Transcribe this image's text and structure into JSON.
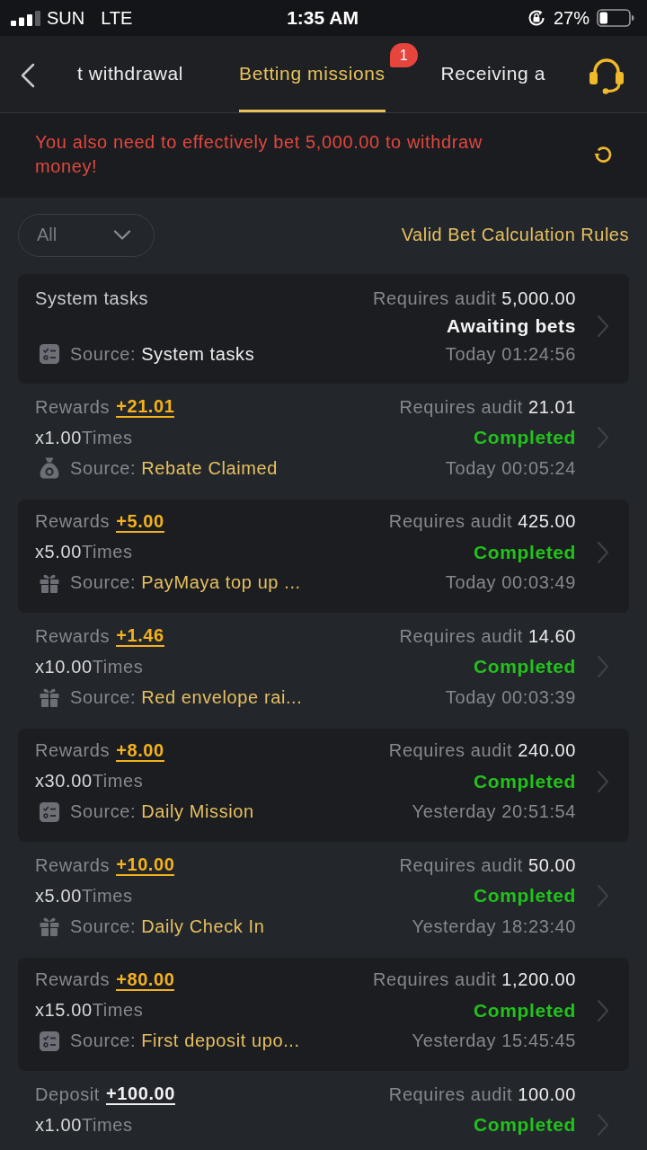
{
  "status_bar": {
    "carrier": "SUN",
    "network": "LTE",
    "time": "1:35 AM",
    "battery": "27%"
  },
  "nav": {
    "tabs": [
      {
        "label": "t withdrawal",
        "selected": false
      },
      {
        "label": "Betting missions",
        "selected": true,
        "badge": "1"
      },
      {
        "label": "Receiving a",
        "selected": false
      }
    ]
  },
  "notice": {
    "text": "You also need to effectively bet 5,000.00 to withdraw money!"
  },
  "filter": {
    "value": "All",
    "rules_link": "Valid Bet Calculation Rules"
  },
  "tasks": [
    {
      "kind": "system",
      "title": "System tasks",
      "audit_label": "Requires audit",
      "audit": "5,000.00",
      "status": {
        "kind": "awaiting",
        "text": "Awaiting bets"
      },
      "source": {
        "kind": "task",
        "label": "Source:",
        "value": "System tasks"
      },
      "time": "Today 01:24:56"
    },
    {
      "kind": "reward",
      "title": "Rewards",
      "amount": "+21.01",
      "multiplier": "x1.00",
      "times": "Times",
      "audit_label": "Requires audit",
      "audit": "21.01",
      "status": {
        "kind": "completed",
        "text": "Completed"
      },
      "source": {
        "kind": "rebate",
        "label": "Source:",
        "value": "Rebate Claimed"
      },
      "time": "Today 00:05:24"
    },
    {
      "kind": "reward",
      "title": "Rewards",
      "amount": "+5.00",
      "multiplier": "x5.00",
      "times": "Times",
      "audit_label": "Requires audit",
      "audit": "425.00",
      "status": {
        "kind": "completed",
        "text": "Completed"
      },
      "source": {
        "kind": "gift",
        "label": "Source:",
        "value": "PayMaya top up ..."
      },
      "time": "Today 00:03:49"
    },
    {
      "kind": "reward",
      "title": "Rewards",
      "amount": "+1.46",
      "multiplier": "x10.00",
      "times": "Times",
      "audit_label": "Requires audit",
      "audit": "14.60",
      "status": {
        "kind": "completed",
        "text": "Completed"
      },
      "source": {
        "kind": "gift",
        "label": "Source:",
        "value": "Red envelope rai..."
      },
      "time": "Today 00:03:39"
    },
    {
      "kind": "reward",
      "title": "Rewards",
      "amount": "+8.00",
      "multiplier": "x30.00",
      "times": "Times",
      "audit_label": "Requires audit",
      "audit": "240.00",
      "status": {
        "kind": "completed",
        "text": "Completed"
      },
      "source": {
        "kind": "task",
        "label": "Source:",
        "value": "Daily Mission"
      },
      "time": "Yesterday 20:51:54"
    },
    {
      "kind": "reward",
      "title": "Rewards",
      "amount": "+10.00",
      "multiplier": "x5.00",
      "times": "Times",
      "audit_label": "Requires audit",
      "audit": "50.00",
      "status": {
        "kind": "completed",
        "text": "Completed"
      },
      "source": {
        "kind": "gift",
        "label": "Source:",
        "value": "Daily Check In"
      },
      "time": "Yesterday 18:23:40"
    },
    {
      "kind": "reward",
      "title": "Rewards",
      "amount": "+80.00",
      "multiplier": "x15.00",
      "times": "Times",
      "audit_label": "Requires audit",
      "audit": "1,200.00",
      "status": {
        "kind": "completed",
        "text": "Completed"
      },
      "source": {
        "kind": "task",
        "label": "Source:",
        "value": "First deposit upo..."
      },
      "time": "Yesterday 15:45:45"
    },
    {
      "kind": "deposit",
      "title": "Deposit",
      "amount": "+100.00",
      "multiplier": "x1.00",
      "times": "Times",
      "audit_label": "Requires audit",
      "audit": "100.00",
      "status": {
        "kind": "completed",
        "text": "Completed"
      }
    }
  ]
}
